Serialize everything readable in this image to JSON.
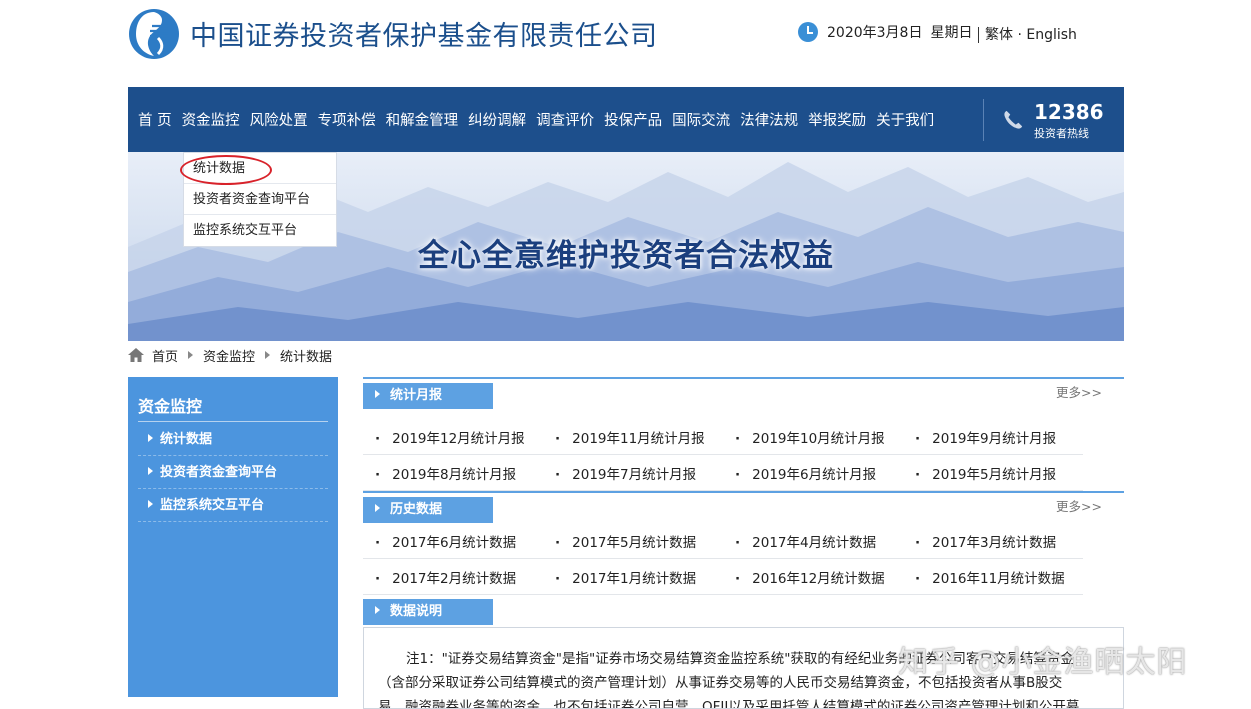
{
  "header": {
    "site_title": "中国证券投资者保护基金有限责任公司",
    "date": "2020年3月8日",
    "weekday": "星期日",
    "lang_traditional": "繁体",
    "lang_dot": "·",
    "lang_english": "English"
  },
  "nav": {
    "items": [
      "首 页",
      "资金监控",
      "风险处置",
      "专项补偿",
      "和解金管理",
      "纠纷调解",
      "调查评价",
      "投保产品",
      "国际交流",
      "法律法规",
      "举报奖励",
      "关于我们"
    ],
    "hotline_number": "12386",
    "hotline_label": "投资者热线"
  },
  "dropdown": {
    "items": [
      "统计数据",
      "投资者资金查询平台",
      "监控系统交互平台"
    ]
  },
  "banner": {
    "slogan": "全心全意维护投资者合法权益"
  },
  "breadcrumb": {
    "items": [
      "首页",
      "资金监控",
      "统计数据"
    ]
  },
  "sidebar": {
    "title": "资金监控",
    "items": [
      "统计数据",
      "投资者资金查询平台",
      "监控系统交互平台"
    ]
  },
  "sections": {
    "monthly": {
      "title": "统计月报",
      "more": "更多>>",
      "rows": [
        [
          "2019年12月统计月报",
          "2019年11月统计月报",
          "2019年10月统计月报",
          "2019年9月统计月报"
        ],
        [
          "2019年8月统计月报",
          "2019年7月统计月报",
          "2019年6月统计月报",
          "2019年5月统计月报"
        ]
      ]
    },
    "history": {
      "title": "历史数据",
      "more": "更多>>",
      "rows": [
        [
          "2017年6月统计数据",
          "2017年5月统计数据",
          "2017年4月统计数据",
          "2017年3月统计数据"
        ],
        [
          "2017年2月统计数据",
          "2017年1月统计数据",
          "2016年12月统计数据",
          "2016年11月统计数据"
        ]
      ]
    },
    "notes": {
      "title": "数据说明",
      "lines": [
        "注1：\"证券交易结算资金\"是指\"证券市场交易结算资金监控系统\"获取的有经纪业务的证券公司客户交易结算资金",
        "（含部分采取证券公司结算模式的资产管理计划）从事证券交易等的人民币交易结算资金，不包括投资者从事B股交",
        "易、融资融券业务等的资金，也不包括证券公司自营、QFII以及采用托管人结算模式的证券公司资产管理计划和公开募"
      ]
    }
  },
  "watermark": "知乎 @小金渔晒太阳",
  "colors": {
    "nav_bg": "#1d4f8c",
    "sidebar_bg": "#4c95de",
    "section_tab": "#5da1e2",
    "highlight_ring": "#d8222a"
  }
}
